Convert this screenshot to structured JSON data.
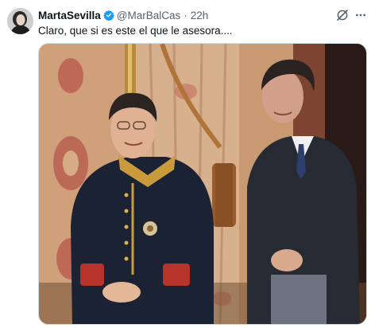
{
  "post": {
    "author_name": "MartaSevilla",
    "handle": "@MarBalCas",
    "separator": "·",
    "timestamp": "22h",
    "text": "Claro, que si es este el que le asesora...."
  },
  "icons": {
    "verified": "verified-badge-icon",
    "grok": "grok-icon",
    "more": "more-options-icon"
  },
  "colors": {
    "verified_blue": "#1d9bf0",
    "secondary_text": "#536471",
    "primary_text": "#0f1419"
  }
}
